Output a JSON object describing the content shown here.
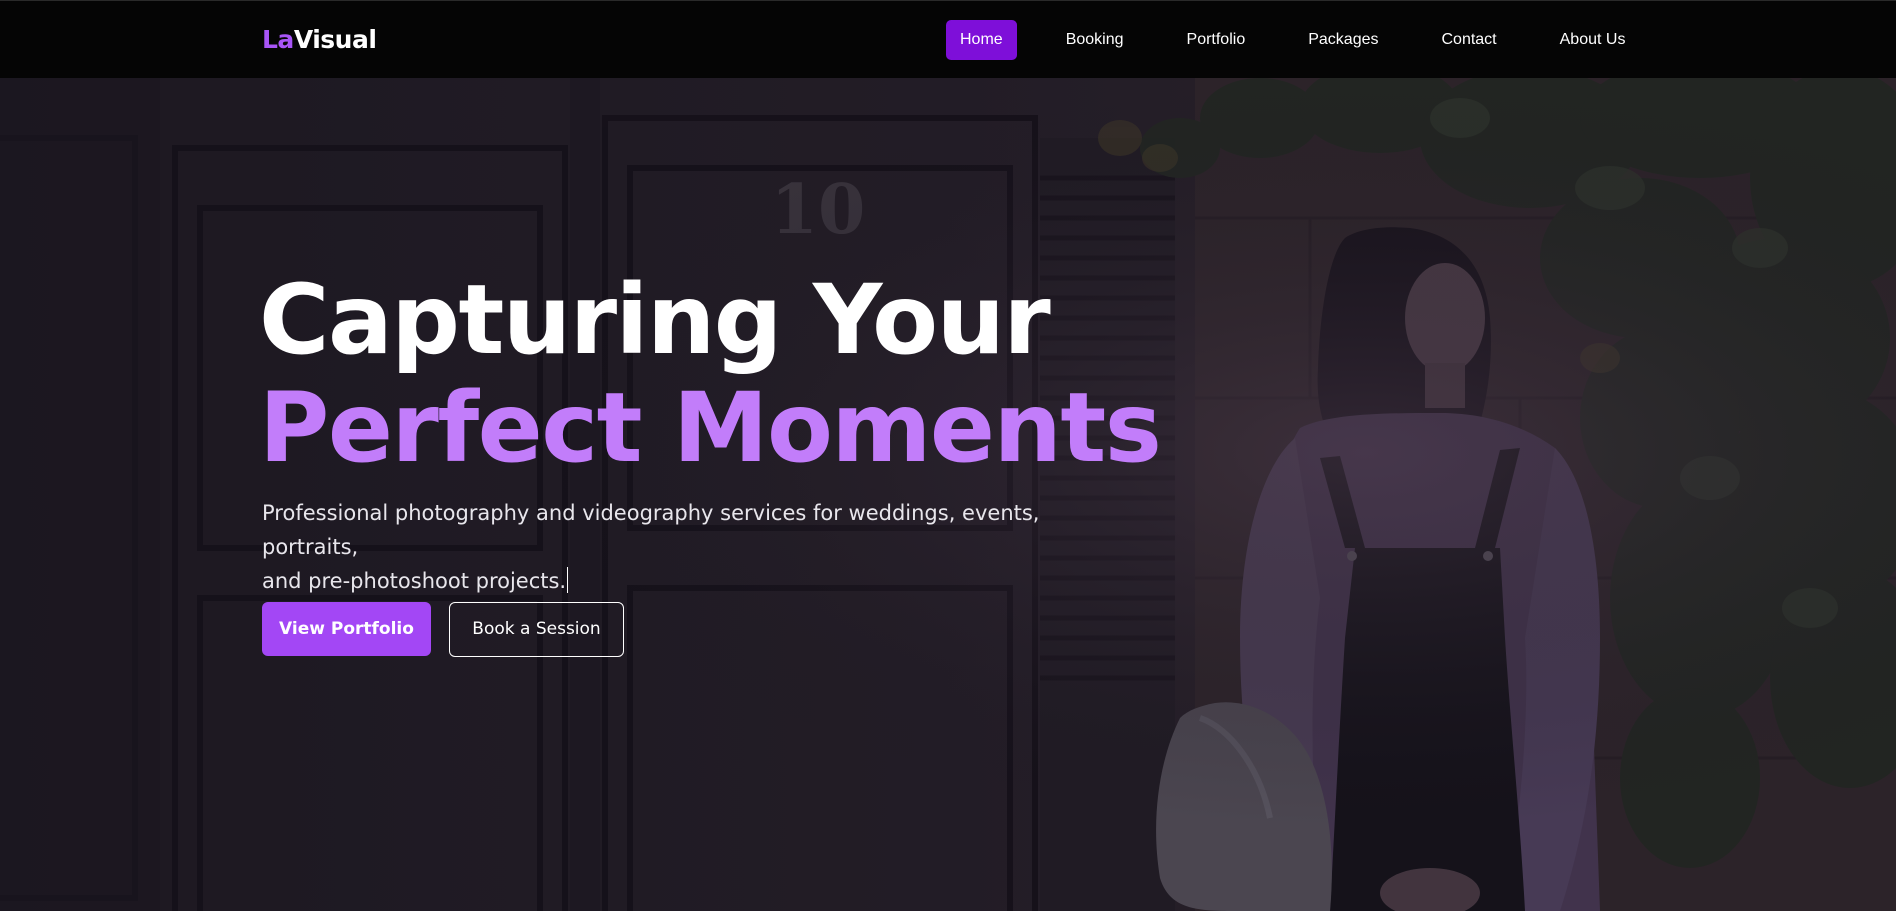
{
  "logo": {
    "part1": "La",
    "part2": "Visual"
  },
  "nav": {
    "items": [
      {
        "label": "Home",
        "active": true
      },
      {
        "label": "Booking",
        "active": false
      },
      {
        "label": "Portfolio",
        "active": false
      },
      {
        "label": "Packages",
        "active": false
      },
      {
        "label": "Contact",
        "active": false
      },
      {
        "label": "About Us",
        "active": false
      }
    ]
  },
  "hero": {
    "headline_line1": "Capturing Your",
    "headline_line2": "Perfect Moments",
    "subtitle_line1": "Professional photography and videography services for weddings, events, portraits,",
    "subtitle_line2": "and pre-photoshoot projects.",
    "primary_button": "View Portfolio",
    "secondary_button": "Book a Session",
    "door_number": "10"
  },
  "colors": {
    "accent": "#a855f7",
    "accent_light": "#c27dfa",
    "active_nav": "#7e0fd9",
    "navbar_bg": "#050505",
    "overlay": "#1b1820"
  }
}
